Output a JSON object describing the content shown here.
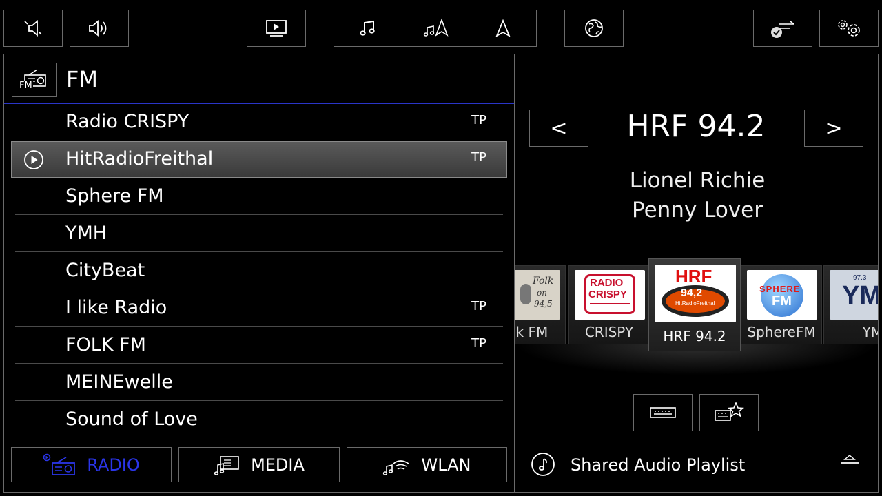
{
  "topbar": {
    "icons": [
      "mute-icon",
      "volume-icon",
      "video-icon",
      "music-icon",
      "music-nav-icon",
      "navigation-icon",
      "globe-icon",
      "connection-icon",
      "settings-icon"
    ]
  },
  "header": {
    "source_badge": "FM",
    "title": "FM"
  },
  "stations": [
    {
      "name": "Radio CRISPY",
      "tp": "TP",
      "active": false
    },
    {
      "name": "HitRadioFreithal",
      "tp": "TP",
      "active": true
    },
    {
      "name": "Sphere FM",
      "tp": "",
      "active": false
    },
    {
      "name": "YMH",
      "tp": "",
      "active": false
    },
    {
      "name": "CityBeat",
      "tp": "",
      "active": false
    },
    {
      "name": "I like Radio",
      "tp": "TP",
      "active": false
    },
    {
      "name": "FOLK FM",
      "tp": "TP",
      "active": false
    },
    {
      "name": "MEINEwelle",
      "tp": "",
      "active": false
    },
    {
      "name": "Sound of Love",
      "tp": "",
      "active": false
    }
  ],
  "tabs": {
    "radio": "RADIO",
    "media": "MEDIA",
    "wlan": "WLAN"
  },
  "now_playing": {
    "prev": "<",
    "next": ">",
    "frequency": "HRF 94.2",
    "artist": "Lionel Richie",
    "title": "Penny Lover"
  },
  "carousel": {
    "folk": {
      "name": "lk FM",
      "logo_line1": "Folk",
      "logo_line2": "on",
      "logo_line3": "94,5"
    },
    "crispy": {
      "name": "CRISPY",
      "logo_line1": "RADIO",
      "logo_line2": "CRISPY"
    },
    "hrf": {
      "name": "HRF 94.2",
      "logo_line1": "HRF",
      "logo_line2": "94,2",
      "logo_line3": "HitRadioFreithal"
    },
    "sphere": {
      "name": "SphereFM",
      "logo_line1": "SPHERE",
      "logo_line2": "FM"
    },
    "ymh": {
      "name": "YMH",
      "logo_line1": "YMH",
      "logo_line2": "97.3"
    }
  },
  "shared_audio": {
    "label": "Shared Audio Playlist"
  },
  "colors": {
    "accent_blue": "#2a35e8",
    "background": "#000000",
    "border": "#6a6a6a"
  }
}
